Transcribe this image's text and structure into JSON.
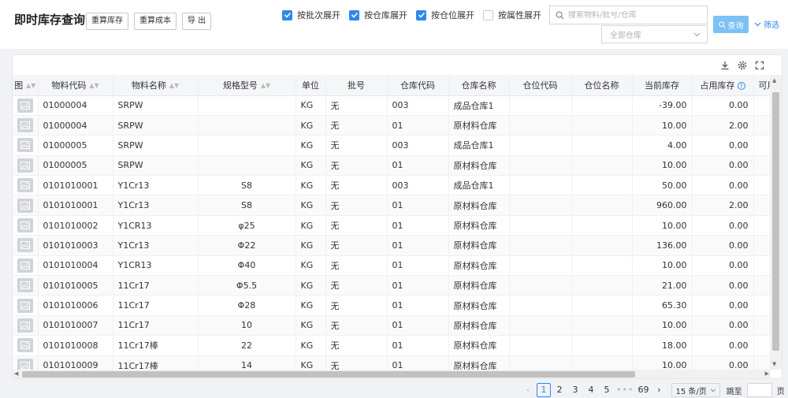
{
  "header": {
    "title": "即时库存查询",
    "buttons": {
      "recalc_stock": "重算库存",
      "recalc_cost": "重算成本",
      "export": "导 出"
    },
    "checkboxes": [
      {
        "label": "按批次展开",
        "checked": true
      },
      {
        "label": "按仓库展开",
        "checked": true
      },
      {
        "label": "按仓位展开",
        "checked": true
      },
      {
        "label": "按属性展开",
        "checked": false
      }
    ],
    "search_placeholder": "搜索物料/批号/仓库",
    "warehouse_select": "全部仓库",
    "query_label": "查询",
    "filter_label": "筛选"
  },
  "table": {
    "columns": [
      "图",
      "物料代码",
      "物料名称",
      "规格型号",
      "单位",
      "批号",
      "仓库代码",
      "仓库名称",
      "仓位代码",
      "仓位名称",
      "当前库存",
      "占用库存",
      "可用库存"
    ],
    "rows": [
      [
        "01000004",
        "SRPW",
        "",
        "KG",
        "无",
        "003",
        "成品仓库1",
        "",
        "",
        "-39.00",
        "0.00"
      ],
      [
        "01000004",
        "SRPW",
        "",
        "KG",
        "无",
        "01",
        "原材料仓库",
        "",
        "",
        "10.00",
        "2.00"
      ],
      [
        "01000005",
        "SRPW",
        "",
        "KG",
        "无",
        "003",
        "成品仓库1",
        "",
        "",
        "4.00",
        "0.00"
      ],
      [
        "01000005",
        "SRPW",
        "",
        "KG",
        "无",
        "01",
        "原材料仓库",
        "",
        "",
        "10.00",
        "0.00"
      ],
      [
        "0101010001",
        "Y1Cr13",
        "S8",
        "KG",
        "无",
        "003",
        "成品仓库1",
        "",
        "",
        "50.00",
        "0.00"
      ],
      [
        "0101010001",
        "Y1Cr13",
        "S8",
        "KG",
        "无",
        "01",
        "原材料仓库",
        "",
        "",
        "960.00",
        "2.00"
      ],
      [
        "0101010002",
        "Y1CR13",
        "φ25",
        "KG",
        "无",
        "01",
        "原材料仓库",
        "",
        "",
        "10.00",
        "0.00"
      ],
      [
        "0101010003",
        "Y1Cr13",
        "Φ22",
        "KG",
        "无",
        "01",
        "原材料仓库",
        "",
        "",
        "136.00",
        "0.00"
      ],
      [
        "0101010004",
        "Y1CR13",
        "Φ40",
        "KG",
        "无",
        "01",
        "原材料仓库",
        "",
        "",
        "10.00",
        "0.00"
      ],
      [
        "0101010005",
        "11Cr17",
        "Φ5.5",
        "KG",
        "无",
        "01",
        "原材料仓库",
        "",
        "",
        "21.00",
        "0.00"
      ],
      [
        "0101010006",
        "11Cr17",
        "Φ28",
        "KG",
        "无",
        "01",
        "原材料仓库",
        "",
        "",
        "65.30",
        "0.00"
      ],
      [
        "0101010007",
        "11Cr17",
        "10",
        "KG",
        "无",
        "01",
        "原材料仓库",
        "",
        "",
        "10.00",
        "0.00"
      ],
      [
        "0101010008",
        "11Cr17棒",
        "22",
        "KG",
        "无",
        "01",
        "原材料仓库",
        "",
        "",
        "18.00",
        "0.00"
      ],
      [
        "0101010009",
        "11Cr17棒",
        "14",
        "KG",
        "无",
        "01",
        "原材料仓库",
        "",
        "",
        "10.00",
        "0.00"
      ]
    ]
  },
  "pagination": {
    "pages": [
      "1",
      "2",
      "3",
      "4",
      "5"
    ],
    "ellipsis": "•••",
    "last": "69",
    "page_size": "15 条/页",
    "jump_label": "跳至",
    "page_unit": "页"
  },
  "colors": {
    "accent": "#2f88ea",
    "query_button": "#7cc1f5",
    "header_bg": "#f5f6f8"
  }
}
